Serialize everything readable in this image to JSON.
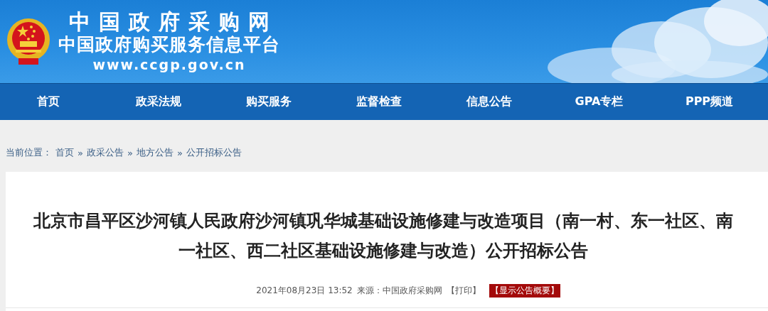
{
  "header": {
    "title": "中国政府采购网",
    "subtitle": "中国政府购买服务信息平台",
    "url": "www.ccgp.gov.cn"
  },
  "nav": [
    {
      "label": "首页"
    },
    {
      "label": "政采法规"
    },
    {
      "label": "购买服务"
    },
    {
      "label": "监督检查"
    },
    {
      "label": "信息公告"
    },
    {
      "label": "GPA专栏"
    },
    {
      "label": "PPP频道"
    }
  ],
  "breadcrumb": {
    "label": "当前位置：",
    "separator": "»",
    "items": [
      "首页",
      "政采公告",
      "地方公告",
      "公开招标公告"
    ]
  },
  "article": {
    "title": "北京市昌平区沙河镇人民政府沙河镇巩华城基础设施修建与改造项目（南一村、东一社区、南一社区、西二社区基础设施修建与改造）公开招标公告",
    "datetime": "2021年08月23日 13:52",
    "source": "来源：中国政府采购网",
    "print": "【打印】",
    "summary_button": "【显示公告概要】"
  }
}
